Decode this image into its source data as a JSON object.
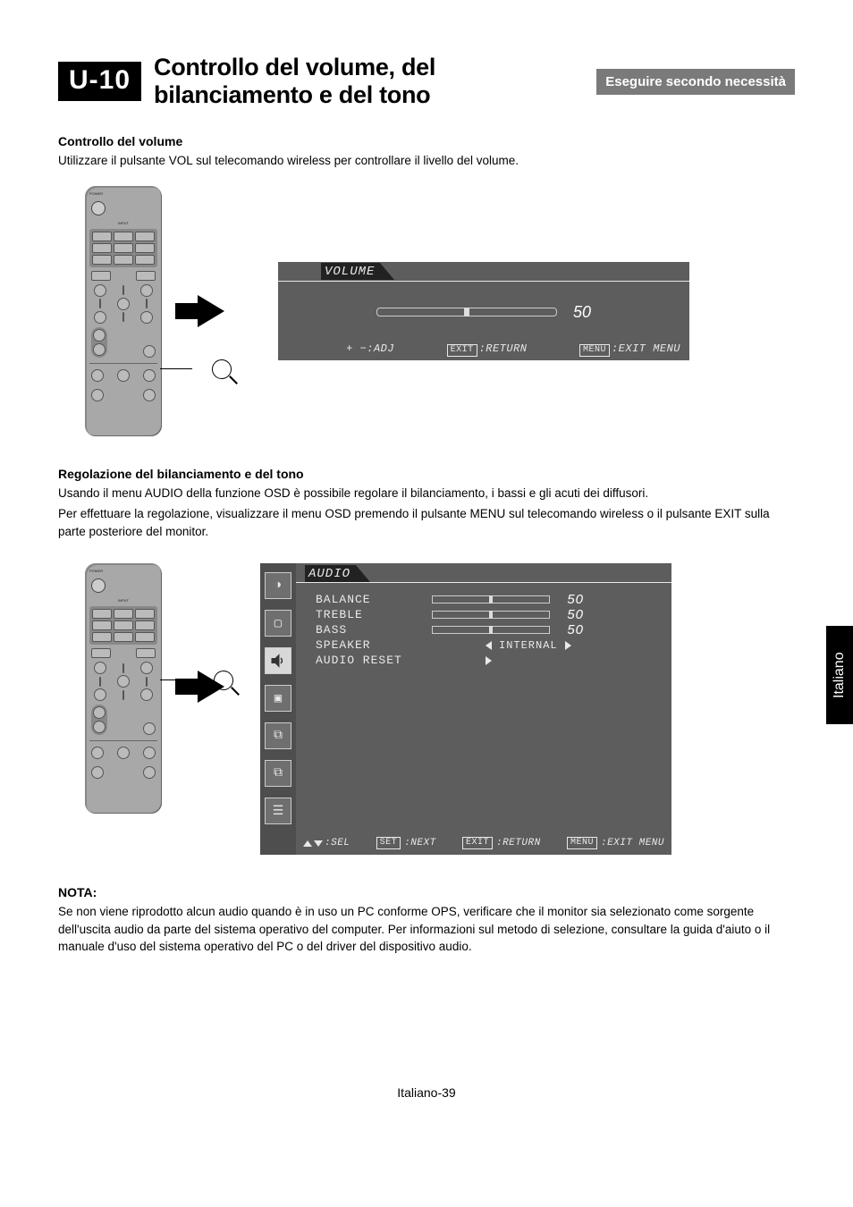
{
  "header": {
    "chapter_code": "U-10",
    "chapter_title": "Controllo del volume, del bilanciamento e del tono",
    "necessity_label": "Eseguire secondo necessità"
  },
  "section_volume": {
    "heading": "Controllo del volume",
    "body": "Utilizzare il pulsante VOL sul telecomando wireless per controllare il livello del volume."
  },
  "osd_volume": {
    "title": "VOLUME",
    "value": "50",
    "legend_adj_keys": "+ −",
    "legend_adj_label": ":ADJ",
    "legend_return_key": "EXIT",
    "legend_return_label": ":RETURN",
    "legend_menu_key": "MENU",
    "legend_menu_label": ":EXIT MENU"
  },
  "section_tone": {
    "heading": "Regolazione del bilanciamento e del tono",
    "body1": "Usando il menu AUDIO della funzione OSD è possibile regolare il bilanciamento, i bassi e gli acuti dei diffusori.",
    "body2": "Per effettuare la regolazione, visualizzare il menu OSD premendo il pulsante MENU sul telecomando wireless o il pulsante EXIT sulla parte posteriore del monitor."
  },
  "osd_audio": {
    "title": "AUDIO",
    "rows": {
      "balance_label": "BALANCE",
      "balance_value": "50",
      "treble_label": "TREBLE",
      "treble_value": "50",
      "bass_label": "BASS",
      "bass_value": "50",
      "speaker_label": "SPEAKER",
      "speaker_value": "INTERNAL",
      "reset_label": "AUDIO RESET"
    },
    "legend": {
      "sel_label": ":SEL",
      "set_key": "SET",
      "set_label": ":NEXT",
      "exit_key": "EXIT",
      "exit_label": ":RETURN",
      "menu_key": "MENU",
      "menu_label": ":EXIT MENU"
    }
  },
  "note": {
    "heading": "NOTA:",
    "body": "Se non viene riprodotto alcun audio quando è in uso un PC conforme OPS, verificare che il monitor sia selezionato come sorgente dell'uscita audio da parte del sistema operativo del computer. Per informazioni sul metodo di selezione, consultare la guida d'aiuto o il manuale d'uso del sistema operativo del PC o del driver del dispositivo audio."
  },
  "side_tab": "Italiano",
  "footer": "Italiano-39"
}
